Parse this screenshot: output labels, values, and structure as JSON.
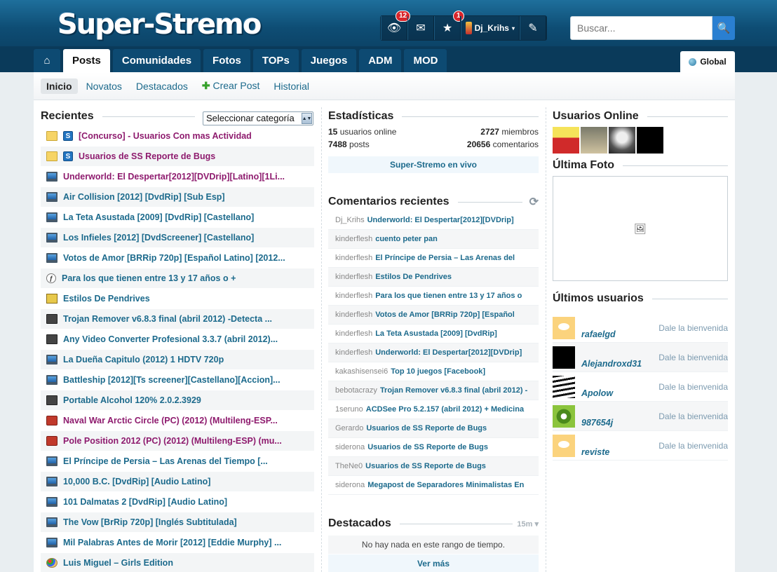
{
  "header": {
    "logo_text": "Super-Stremo",
    "user_bar": {
      "notifications_count": "12",
      "messages_count": "1",
      "username": "Dj_Krihs"
    },
    "search": {
      "placeholder": "Buscar..."
    }
  },
  "nav": {
    "tabs": [
      {
        "label": "Posts"
      },
      {
        "label": "Comunidades"
      },
      {
        "label": "Fotos"
      },
      {
        "label": "TOPs"
      },
      {
        "label": "Juegos"
      },
      {
        "label": "ADM"
      },
      {
        "label": "MOD"
      }
    ],
    "global_label": "Global"
  },
  "subnav": {
    "items": [
      {
        "label": "Inicio"
      },
      {
        "label": "Novatos"
      },
      {
        "label": "Destacados"
      },
      {
        "label": "Crear Post"
      },
      {
        "label": "Historial"
      }
    ]
  },
  "recientes": {
    "title": "Recientes",
    "category_select": "Seleccionar categoría",
    "posts": [
      {
        "icon": "folder-icon",
        "title": "[Concurso] - Usuarios Con mas Actividad"
      },
      {
        "icon": "folder-icon",
        "title": "Usuarios de SS Reporte de Bugs"
      },
      {
        "icon": "monitor-icon",
        "title": "Underworld: El Despertar[2012][DVDrip][Latino][1Li..."
      },
      {
        "icon": "monitor-icon",
        "title": "Air Collision [2012] [DvdRip] [Sub Esp]"
      },
      {
        "icon": "monitor-icon",
        "title": "La Teta Asustada [2009] [DvdRip] [Castellano]"
      },
      {
        "icon": "monitor-icon",
        "title": "Los Infieles [2012] [DvdScreener] [Castellano]"
      },
      {
        "icon": "monitor-icon",
        "title": "Votos de Amor [BRRip 720p] [Español Latino] [2012..."
      },
      {
        "icon": "flash-icon",
        "title": "Para los que tienen entre 13 y 17 años o +"
      },
      {
        "icon": "image-icon",
        "title": "Estilos De Pendrives"
      },
      {
        "icon": "disk-icon",
        "title": "Trojan Remover v6.8.3 final (abril 2012) -Detecta ..."
      },
      {
        "icon": "disk-icon",
        "title": "Any Video Converter Profesional 3.3.7 (abril 2012)..."
      },
      {
        "icon": "monitor-icon",
        "title": "La Dueña Capitulo (2012) 1 HDTV 720p"
      },
      {
        "icon": "monitor-icon",
        "title": "Battleship [2012][Ts screener][Castellano][Accion]..."
      },
      {
        "icon": "disk-icon",
        "title": "Portable Alcohol 120% 2.0.2.3929"
      },
      {
        "icon": "game-icon",
        "title": "Naval War Arctic Circle (PC) (2012) (Multileng-ESP..."
      },
      {
        "icon": "game-icon",
        "title": "Pole Position 2012 (PC) (2012) (Multileng-ESP) (mu..."
      },
      {
        "icon": "monitor-icon",
        "title": "El Príncipe de Persia – Las Arenas del Tiempo [..."
      },
      {
        "icon": "monitor-icon",
        "title": "10,000 B.C. [DvdRip] [Audio Latino]"
      },
      {
        "icon": "monitor-icon",
        "title": "101 Dalmatas 2 [DvdRip] [Audio Latino]"
      },
      {
        "icon": "monitor-icon",
        "title": "The Vow [BrRip 720p] [Inglés Subtitulada]"
      },
      {
        "icon": "monitor-icon",
        "title": "Mil Palabras Antes de Morir [2012] [Eddie Murphy] ..."
      },
      {
        "icon": "paint-icon",
        "title": "Luis Miguel – Girls Edition"
      }
    ]
  },
  "estadisticas": {
    "title": "Estadísticas",
    "online_count": "15",
    "online_label": "usuarios online",
    "members_count": "2727",
    "members_label": "miembros",
    "posts_count": "7488",
    "posts_label": "posts",
    "comments_count": "20656",
    "comments_label": "comentarios",
    "live_link": "Super-Stremo en vivo"
  },
  "comentarios": {
    "title": "Comentarios recientes",
    "items": [
      {
        "user": "Dj_Krihs",
        "post": "Underworld: El Despertar[2012][DVDrip]"
      },
      {
        "user": "kinderflesh",
        "post": "cuento peter pan"
      },
      {
        "user": "kinderflesh",
        "post": "El Príncipe de Persia – Las Arenas del"
      },
      {
        "user": "kinderflesh",
        "post": "Estilos De Pendrives"
      },
      {
        "user": "kinderflesh",
        "post": "Para los que tienen entre 13 y 17 años o"
      },
      {
        "user": "kinderflesh",
        "post": "Votos de Amor [BRRip 720p] [Español"
      },
      {
        "user": "kinderflesh",
        "post": "La Teta Asustada [2009] [DvdRip]"
      },
      {
        "user": "kinderflesh",
        "post": "Underworld: El Despertar[2012][DVDrip]"
      },
      {
        "user": "kakashisensei6",
        "post": "Top 10 juegos [Facebook]"
      },
      {
        "user": "bebotacrazy",
        "post": "Trojan Remover v6.8.3 final (abril 2012) -"
      },
      {
        "user": "1seruno",
        "post": "ACDSee Pro 5.2.157 (abril 2012) + Medicina"
      },
      {
        "user": "Gerardo",
        "post": "Usuarios de SS Reporte de Bugs"
      },
      {
        "user": "siderona",
        "post": "Usuarios de SS Reporte de Bugs"
      },
      {
        "user": "TheNe0",
        "post": "Usuarios de SS Reporte de Bugs"
      },
      {
        "user": "siderona",
        "post": "Megapost de Separadores Minimalistas En"
      }
    ]
  },
  "destacados": {
    "title": "Destacados",
    "range": "15m",
    "empty_text": "No hay nada en este rango de tiempo.",
    "more_link": "Ver más"
  },
  "usuarios_online": {
    "title": "Usuarios Online"
  },
  "ultima_foto": {
    "title": "Última Foto"
  },
  "ultimos_usuarios": {
    "title": "Últimos usuarios",
    "users": [
      {
        "name": "rafaelgd",
        "action": "Dale la bienvenida"
      },
      {
        "name": "Alejandroxd31",
        "action": "Dale la bienvenida"
      },
      {
        "name": "Apolow",
        "action": "Dale la bienvenida"
      },
      {
        "name": "987654j",
        "action": "Dale la bienvenida"
      },
      {
        "name": "reviste",
        "action": "Dale la bienvenida"
      }
    ]
  },
  "colors": {
    "header_blue": "#0e4d74",
    "link_blue": "#1c6a8c",
    "sticky_purple": "#8e1b6e",
    "badge_red": "#d9252b"
  }
}
